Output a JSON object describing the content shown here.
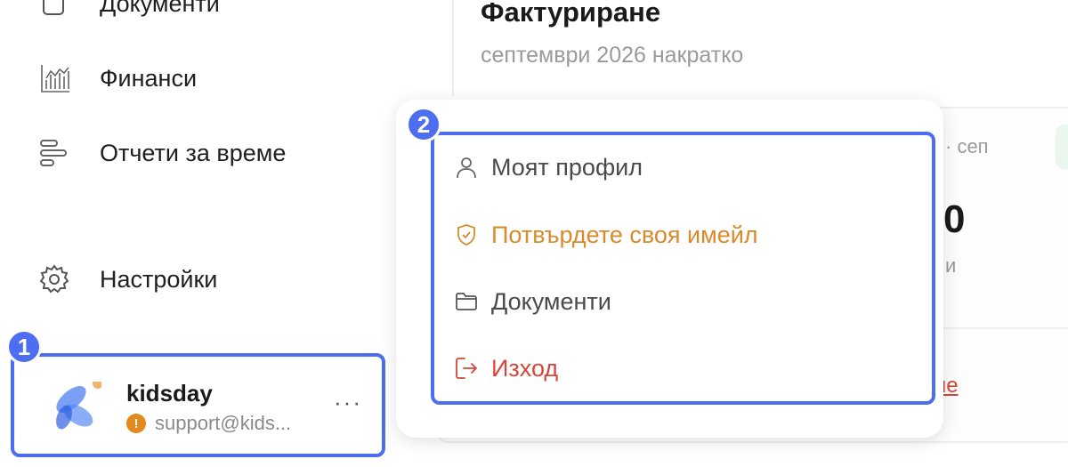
{
  "sidebar": {
    "items": [
      {
        "label": "Документи",
        "icon": "document-icon"
      },
      {
        "label": "Финанси",
        "icon": "chart-icon"
      },
      {
        "label": "Отчети за време",
        "icon": "timeline-icon"
      },
      {
        "label": "Настройки",
        "icon": "gear-icon"
      }
    ],
    "user": {
      "name": "kidsday",
      "email": "support@kids...",
      "warning": "!",
      "more": "···"
    }
  },
  "badges": {
    "one": "1",
    "two": "2"
  },
  "main": {
    "title": "Фактуриране",
    "subtitle": "септември 2026 накратко",
    "card_partial_1": "· сеп",
    "card_partial_2": "0",
    "card_partial_3": "и",
    "card_link": "не"
  },
  "menu": {
    "items": [
      {
        "label": "Моят профил",
        "color": "#4a4a4a"
      },
      {
        "label": "Потвърдете своя имейл",
        "color": "#d98a2b"
      },
      {
        "label": "Документи",
        "color": "#4a4a4a"
      },
      {
        "label": "Изход",
        "color": "#d7463a"
      }
    ]
  },
  "colors": {
    "accent": "#4e6ef2",
    "warning": "#e28a1d",
    "danger": "#d7463a"
  }
}
